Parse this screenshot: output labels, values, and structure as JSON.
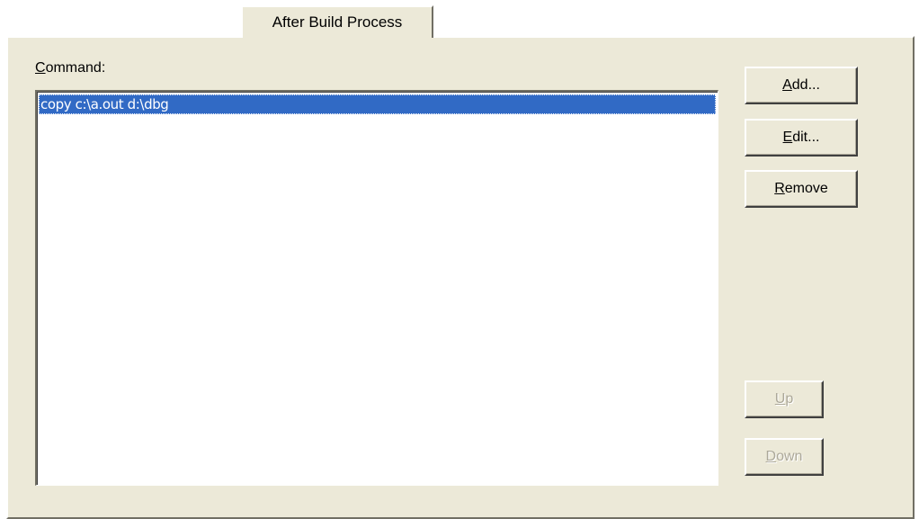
{
  "tab": {
    "label": "After Build Process"
  },
  "command": {
    "label_accel": "C",
    "label_rest": "ommand:",
    "items": [
      "copy c:\\a.out d:\\dbg"
    ],
    "selected_index": 0
  },
  "buttons": {
    "add": {
      "accel": "A",
      "rest": "dd...",
      "enabled": true
    },
    "edit": {
      "accel": "E",
      "rest": "dit...",
      "enabled": true
    },
    "remove": {
      "accel": "R",
      "rest": "emove",
      "enabled": true
    },
    "up": {
      "accel": "U",
      "rest": "p",
      "enabled": false
    },
    "down": {
      "accel": "D",
      "rest": "own",
      "enabled": false
    }
  },
  "colors": {
    "face": "#ece9d8",
    "selection": "#316ac5",
    "disabled_text": "#aca899"
  }
}
